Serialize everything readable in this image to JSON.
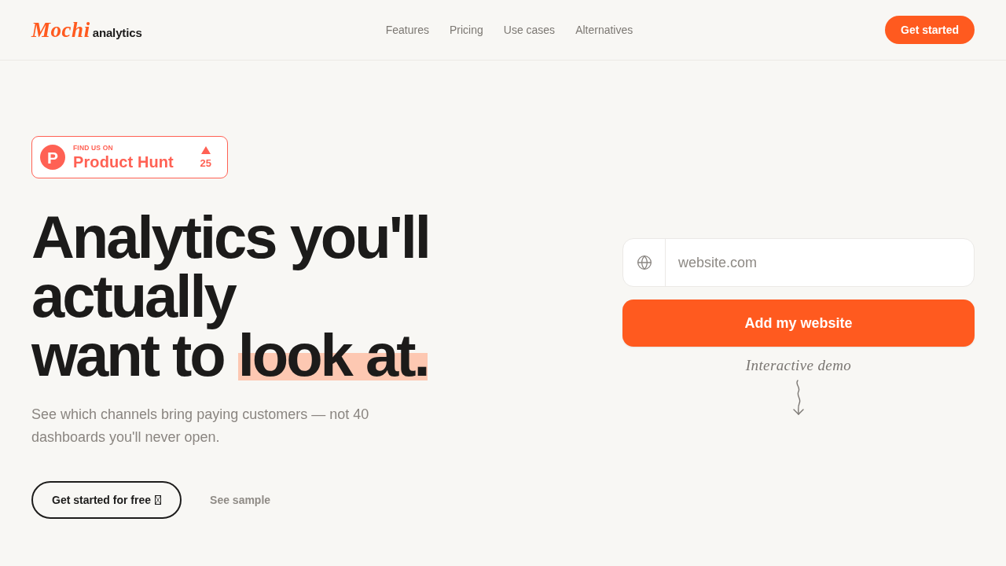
{
  "header": {
    "logo": {
      "script": "Mochi",
      "word": "analytics"
    },
    "nav": [
      "Features",
      "Pricing",
      "Use cases",
      "Alternatives"
    ],
    "cta": "Get started"
  },
  "hero": {
    "badge": {
      "logo_letter": "P",
      "kicker": "FIND US ON",
      "name": "Product Hunt",
      "votes": "25"
    },
    "headline": {
      "lines": [
        "Analytics you'll",
        "actually",
        "want to"
      ],
      "highlight": "look at."
    },
    "subtitle": "See which channels bring paying customers — not 40 dashboards you'll never open.",
    "primary_button": "Get started for free",
    "secondary_link": "See sample"
  },
  "signup": {
    "placeholder": "website.com",
    "button": "Add my website",
    "demo_note": "Interactive demo"
  }
}
